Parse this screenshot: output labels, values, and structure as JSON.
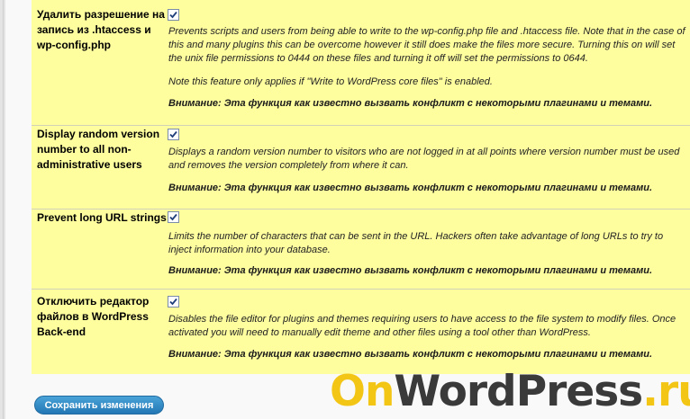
{
  "settings": [
    {
      "label": "Удалить разрешение на запись из .htaccess и wp-config.php",
      "checked": true,
      "description": "Prevents scripts and users from being able to write to the wp-config.php file and .htaccess file. Note that in the case of this and many plugins this can be overcome however it still does make the files more secure. Turning this on will set the unix file permissions to 0444 on these files and turning it off will set the permissions to 0644.",
      "note": "Note this feature only applies if \"Write to WordPress core files\" is enabled.",
      "warning": "Внимание: Эта функция как известно вызвать конфликт с некоторыми плагинами и темами."
    },
    {
      "label": "Display random version number to all non-administrative users",
      "checked": true,
      "description": "Displays a random version number to visitors who are not logged in at all points where version number must be used and removes the version completely from where it can.",
      "warning": "Внимание: Эта функция как известно вызвать конфликт с некоторыми плагинами и темами."
    },
    {
      "label": "Prevent long URL strings",
      "checked": true,
      "description": "Limits the number of characters that can be sent in the URL. Hackers often take advantage of long URLs to try to inject information into your database.",
      "warning": "Внимание: Эта функция как известно вызвать конфликт с некоторыми плагинами и темами."
    },
    {
      "label": "Отключить редактор файлов в WordPress Back-end",
      "checked": true,
      "description": "Disables the file editor for plugins and themes requiring users to have access to the file system to modify files. Once activated you will need to manually edit theme and other files using a tool other than WordPress.",
      "warning": "Внимание: Эта функция как известно вызвать конфликт с некоторыми плагинами и темами."
    }
  ],
  "save_button": "Сохранить изменения",
  "watermark": {
    "part1": "On",
    "part2": "WordPress",
    "part3": ".ru"
  },
  "colors": {
    "row_background": "#fffe9f",
    "button": "#2a82c0",
    "watermark_yellow": "#f3c515"
  }
}
